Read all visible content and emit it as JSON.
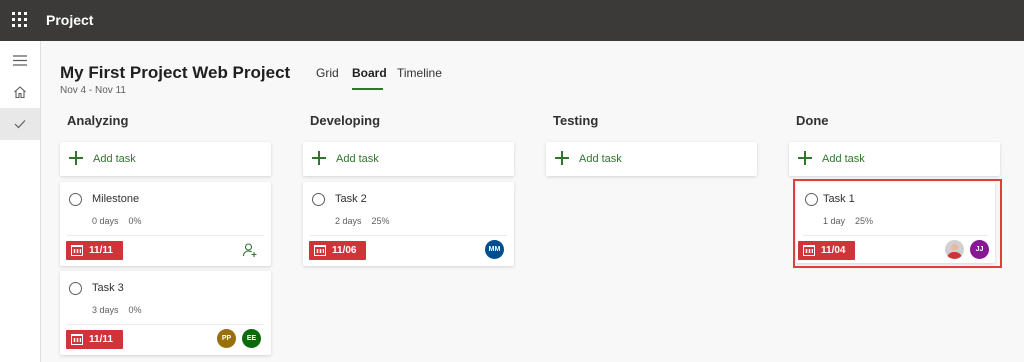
{
  "app": {
    "title": "Project"
  },
  "project": {
    "title": "My First Project Web Project",
    "dates": "Nov 4 - Nov 11"
  },
  "tabs": [
    {
      "label": "Grid",
      "active": false
    },
    {
      "label": "Board",
      "active": true
    },
    {
      "label": "Timeline",
      "active": false
    }
  ],
  "columns": [
    {
      "title": "Analyzing",
      "add_label": "Add task",
      "tasks": [
        {
          "name": "Milestone",
          "duration": "0 days",
          "progress": "0%",
          "due": "11/11",
          "assignees": []
        },
        {
          "name": "Task 3",
          "duration": "3 days",
          "progress": "0%",
          "due": "11/11",
          "assignees": [
            {
              "initials": "PP",
              "color": "#986f0b"
            },
            {
              "initials": "EE",
              "color": "#0b6a0b"
            }
          ]
        }
      ]
    },
    {
      "title": "Developing",
      "add_label": "Add task",
      "tasks": [
        {
          "name": "Task 2",
          "duration": "2 days",
          "progress": "25%",
          "due": "11/06",
          "assignees": [
            {
              "initials": "MM",
              "color": "#004e8c"
            }
          ]
        }
      ]
    },
    {
      "title": "Testing",
      "add_label": "Add task",
      "tasks": []
    },
    {
      "title": "Done",
      "add_label": "Add task",
      "tasks": [
        {
          "name": "Task 1",
          "duration": "1 day",
          "progress": "25%",
          "due": "11/04",
          "assignees": [
            {
              "initials": "",
              "color": "#c9c9c9",
              "photo": true
            },
            {
              "initials": "JJ",
              "color": "#881798"
            }
          ]
        }
      ]
    }
  ],
  "colors": {
    "accent": "#31752f",
    "due_late": "#d13438",
    "topbar": "#3b3a39",
    "highlight": "#e03e3e"
  },
  "icons": {
    "waffle": "app-launcher-icon",
    "menu": "hamburger-icon",
    "home": "home-icon",
    "tasks": "checkmark-icon",
    "assign": "add-person-icon",
    "calendar": "calendar-icon"
  }
}
